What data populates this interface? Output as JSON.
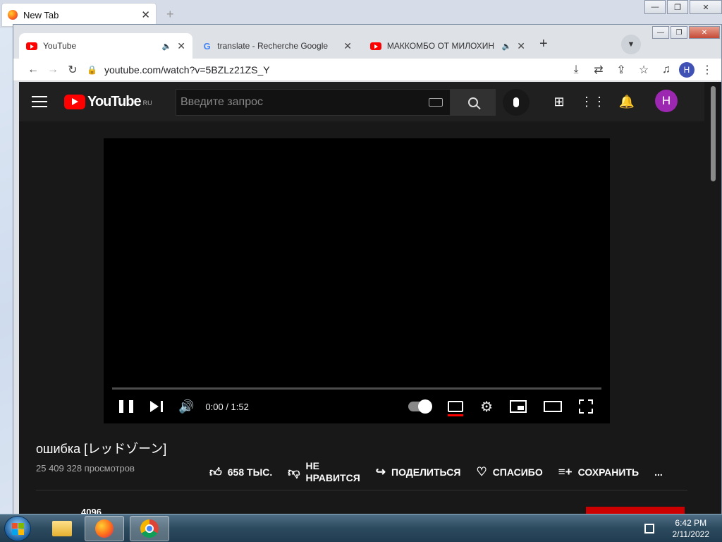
{
  "firefox": {
    "tab_title": "New Tab",
    "new_tab_symbol": "+"
  },
  "window_controls": {
    "minimize": "—",
    "maximize": "❐",
    "close": "✕"
  },
  "chrome": {
    "tabs": [
      {
        "title": "YouTube",
        "favicon": "youtube-icon",
        "audio": true,
        "active": true
      },
      {
        "title": "translate - Recherche Google",
        "favicon": "google-icon",
        "audio": false,
        "active": false
      },
      {
        "title": "МАККОМБО ОТ МИЛОХИН",
        "favicon": "youtube-icon",
        "audio": true,
        "active": false
      }
    ],
    "new_tab_symbol": "+",
    "url": "youtube.com/watch?v=5BZLz21ZS_Y",
    "profile_initial": "H"
  },
  "youtube": {
    "logo_text": "YouTube",
    "region": "RU",
    "search_placeholder": "Введите запрос",
    "avatar_initial": "H",
    "player": {
      "current_time": "0:00",
      "duration": "1:52",
      "time_display": "0:00 / 1:52",
      "progress": 0
    },
    "video": {
      "title": "ошибка [レッドゾーン]",
      "views": "25 409 328 просмотров",
      "likes": "658 ТЫС.",
      "dislike_line1": "НЕ",
      "dislike_line2": "НРАВИТСЯ",
      "share": "ПОДЕЛИТЬСЯ",
      "thanks": "СПАСИБО",
      "save": "СОХРАНИТЬ",
      "more": "..."
    },
    "channel_partial": "4096"
  },
  "taskbar": {
    "time": "6:42 PM",
    "date": "2/11/2022"
  },
  "colors": {
    "yt_red": "#ff0000",
    "yt_bg": "#181818",
    "avatar_purple": "#9c27b0",
    "chrome_tabstrip": "#dee1e6"
  }
}
